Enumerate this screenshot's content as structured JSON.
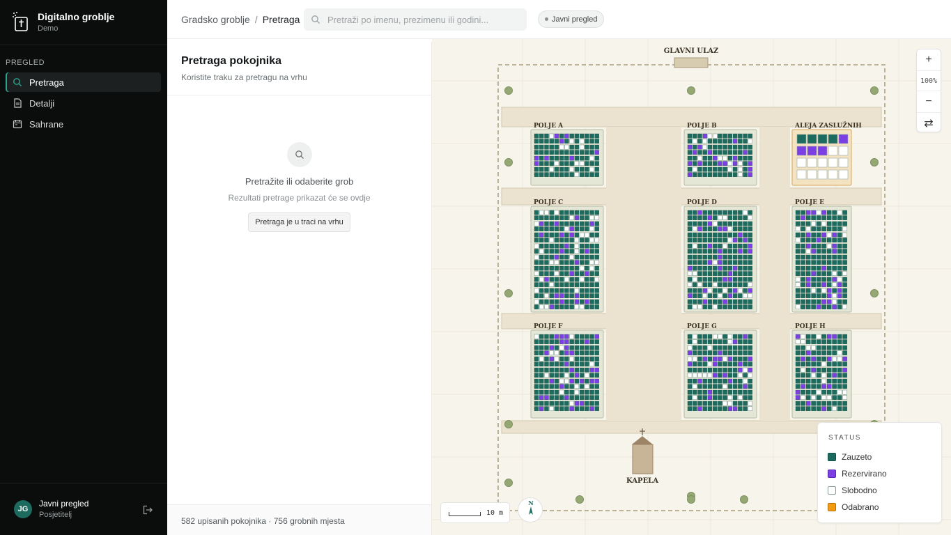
{
  "app": {
    "title": "Digitalno groblje",
    "subtitle": "Demo"
  },
  "sidebar": {
    "section": "PREGLED",
    "items": [
      {
        "label": "Pretraga",
        "icon": "search-icon",
        "active": true
      },
      {
        "label": "Detalji",
        "icon": "document-icon",
        "active": false
      },
      {
        "label": "Sahrane",
        "icon": "calendar-icon",
        "active": false
      }
    ],
    "user": {
      "initials": "JG",
      "name": "Javni pregled",
      "role": "Posjetitelj"
    }
  },
  "header": {
    "breadcrumb": [
      "Gradsko groblje",
      "Pretraga"
    ],
    "search_placeholder": "Pretraži po imenu, prezimenu ili godini...",
    "badge": "Javni pregled"
  },
  "panel": {
    "title": "Pretraga pokojnika",
    "subtitle": "Koristite traku za pretragu na vrhu",
    "empty_title": "Pretražite ili odaberite grob",
    "empty_subtitle": "Rezultati pretrage prikazat će se ovdje",
    "empty_button": "Pretraga je u traci na vrhu",
    "footer": "582 upisanih pokojnika · 756 grobnih mjesta"
  },
  "map": {
    "entrance_label": "GLAVNI ULAZ",
    "chapel_label": "KAPELA",
    "fields": [
      "POLJE A",
      "POLJE B",
      "ALEJA ZASLUŽNIH",
      "POLJE C",
      "POLJE D",
      "POLJE E",
      "POLJE F",
      "POLJE G",
      "POLJE H"
    ],
    "zoom_level": "100%",
    "zoom_in": "+",
    "zoom_out": "−",
    "swap": "⇄",
    "scale_label": "10 m",
    "compass_label": "N",
    "legend": {
      "title": "STATUS",
      "items": [
        {
          "label": "Zauzeto",
          "color": "#1d6b5e"
        },
        {
          "label": "Rezervirano",
          "color": "#7b3fe4"
        },
        {
          "label": "Slobodno",
          "color": "#ffffff"
        },
        {
          "label": "Odabrano",
          "color": "#f39c12"
        }
      ]
    }
  },
  "colors": {
    "accent": "#2aa58f",
    "occupied": "#1d6b5e",
    "reserved": "#7b3fe4",
    "free": "#ffffff",
    "selected": "#f39c12"
  }
}
